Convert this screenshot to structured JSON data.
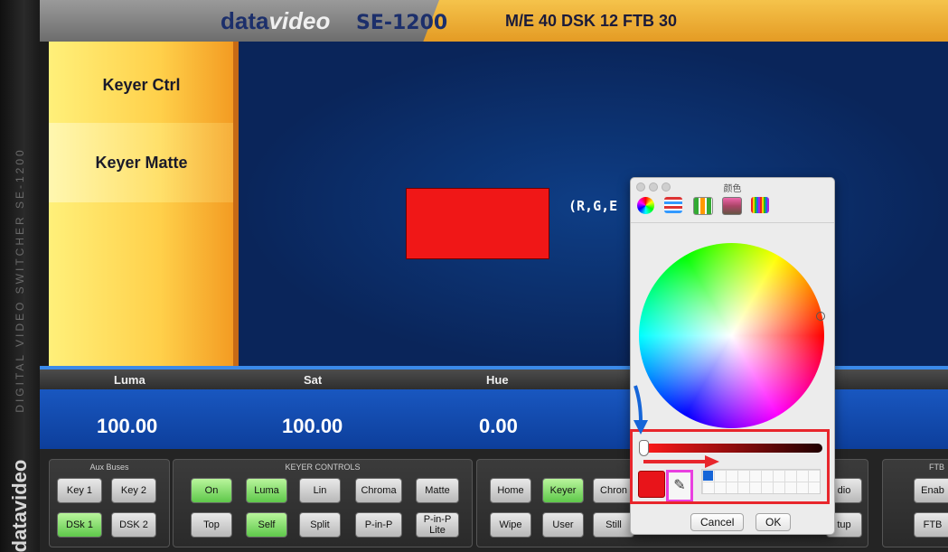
{
  "window": {
    "side_text": "DIGITAL VIDEO SWITCHER   SE-1200",
    "side_logo": "datavideo"
  },
  "header": {
    "logo_main": "data",
    "logo_accent": "video",
    "model": "SE-1200",
    "me_info": "M/E 40  DSK 12  FTB 30"
  },
  "left_panel": {
    "items": [
      "Keyer Ctrl",
      "Keyer Matte"
    ]
  },
  "preview": {
    "rgb_label": "(R,G,E",
    "swatch_color": "#f01717"
  },
  "values": {
    "labels": [
      "Luma",
      "Sat",
      "Hue"
    ],
    "values": [
      "100.00",
      "100.00",
      "0.00"
    ]
  },
  "bottom": {
    "aux_title": "Aux Buses",
    "aux": [
      "Key 1",
      "Key 2",
      "DSk 1",
      "DSK 2"
    ],
    "keyer_title": "KEYER CONTROLS",
    "keyer_row1": [
      "On",
      "Luma",
      "Lin",
      "Chroma",
      "Matte"
    ],
    "keyer_row2": [
      "Top",
      "Self",
      "Split",
      "P-in-P",
      "P-in-P Lite"
    ],
    "panel3_row1": [
      "Home",
      "Keyer",
      "Chron",
      "dio"
    ],
    "panel3_row2": [
      "Wipe",
      "User",
      "Still",
      "tup"
    ],
    "ftb_title": "FTB",
    "ftb": [
      "Enab",
      "FTB"
    ]
  },
  "picker": {
    "title": "颜色",
    "tabs": [
      "color-wheel-icon",
      "sliders-icon",
      "palette-icon",
      "image-icon",
      "crayons-icon"
    ],
    "cancel": "Cancel",
    "ok": "OK",
    "selected_color": "#e8141a",
    "brightness": 1.0
  },
  "annotations": {
    "red_box": "#e8262c",
    "blue_arrow": "#1565d8",
    "pink_box": "#e93fe0"
  }
}
